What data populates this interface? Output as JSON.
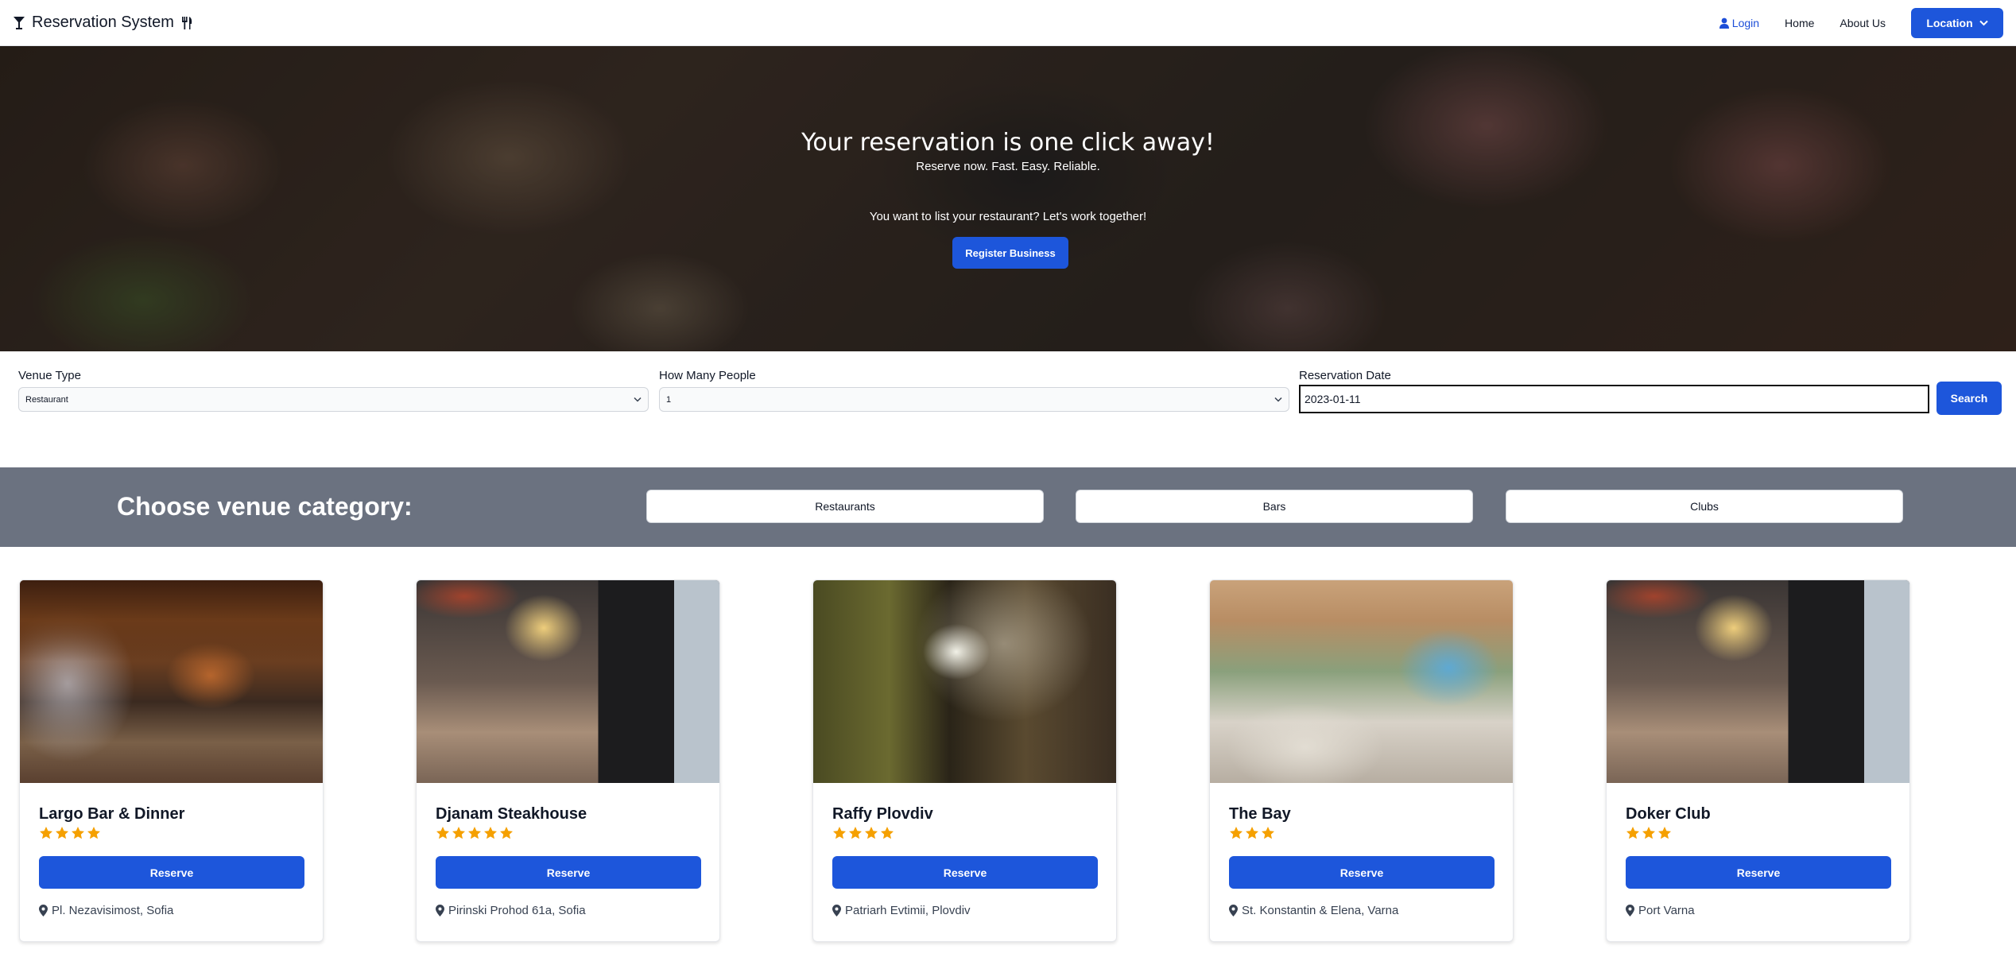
{
  "navbar": {
    "brand": "Reservation System",
    "brand_icons": [
      "cocktail-icon",
      "utensils-icon"
    ],
    "login_label": "Login",
    "home_label": "Home",
    "about_label": "About Us",
    "location_label": "Location"
  },
  "hero": {
    "title": "Your reservation is one click away!",
    "subtitle": "Reserve now. Fast. Easy. Reliable.",
    "cta_text": "You want to list your restaurant? Let's work together!",
    "register_label": "Register Business"
  },
  "search": {
    "venue_type_label": "Venue Type",
    "venue_type_value": "Restaurant",
    "people_label": "How Many People",
    "people_value": "1",
    "date_label": "Reservation Date",
    "date_value": "2023-01-11",
    "search_label": "Search"
  },
  "category": {
    "title": "Choose venue category:",
    "buttons": [
      "Restaurants",
      "Bars",
      "Clubs"
    ]
  },
  "venues": [
    {
      "name": "Largo Bar & Dinner",
      "rating": 4,
      "reserve_label": "Reserve",
      "address": "Pl. Nezavisimost, Sofia"
    },
    {
      "name": "Djanam Steakhouse",
      "rating": 5,
      "reserve_label": "Reserve",
      "address": "Pirinski Prohod 61a, Sofia"
    },
    {
      "name": "Raffy Plovdiv",
      "rating": 4,
      "reserve_label": "Reserve",
      "address": "Patriarh Evtimii, Plovdiv"
    },
    {
      "name": "The Bay",
      "rating": 3,
      "reserve_label": "Reserve",
      "address": "St. Konstantin & Elena, Varna"
    },
    {
      "name": "Doker Club",
      "rating": 3,
      "reserve_label": "Reserve",
      "address": "Port Varna"
    }
  ],
  "colors": {
    "primary": "#1d56db",
    "star": "#f5a000",
    "category_bg": "#6b7280"
  }
}
